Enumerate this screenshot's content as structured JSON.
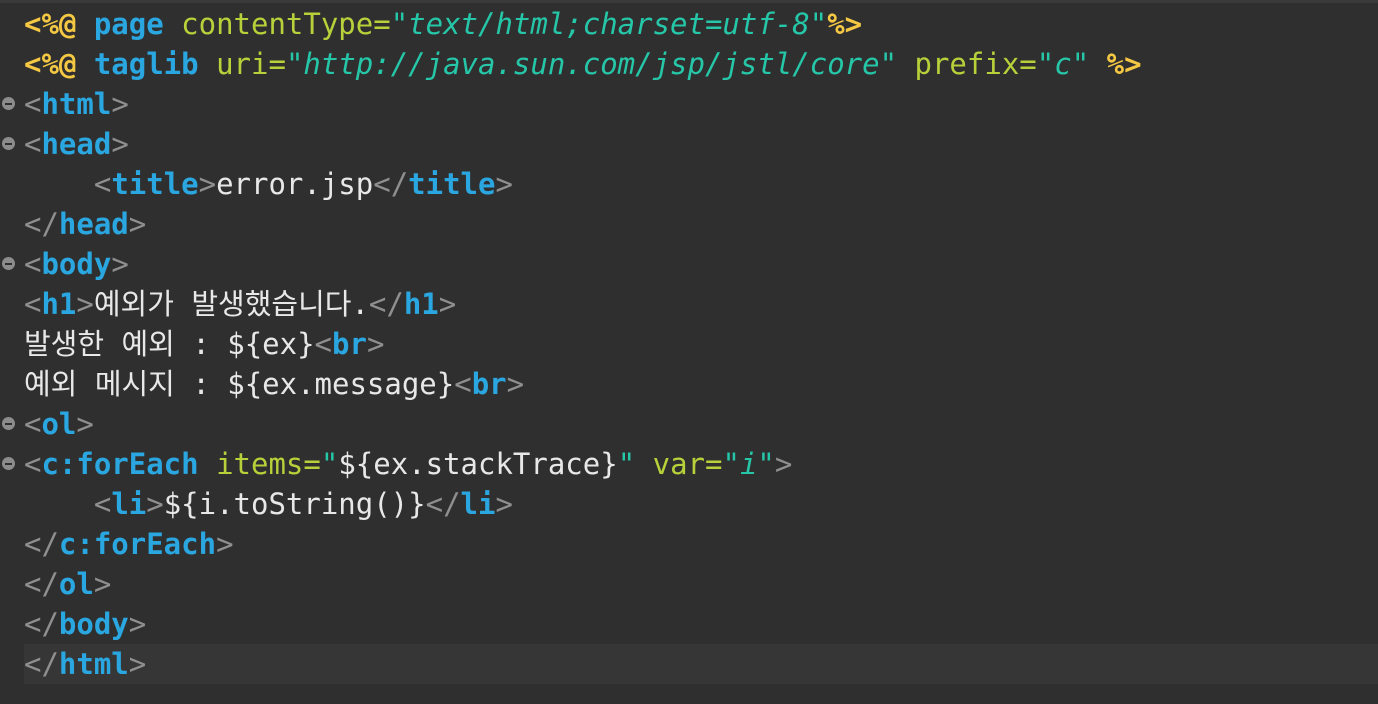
{
  "editor": {
    "lines": [
      {
        "n": 1,
        "fold": false,
        "parts": [
          {
            "c": "dir",
            "t": "<%@ "
          },
          {
            "c": "kw",
            "t": "page"
          },
          {
            "c": "txt",
            "t": " "
          },
          {
            "c": "attr",
            "t": "contentType"
          },
          {
            "c": "eq",
            "t": "="
          },
          {
            "c": "q",
            "t": "\""
          },
          {
            "c": "str",
            "t": "text/html;charset=utf-8"
          },
          {
            "c": "q",
            "t": "\""
          },
          {
            "c": "dir",
            "t": "%>"
          }
        ]
      },
      {
        "n": 2,
        "fold": false,
        "parts": [
          {
            "c": "dir",
            "t": "<%@ "
          },
          {
            "c": "kw",
            "t": "taglib"
          },
          {
            "c": "txt",
            "t": " "
          },
          {
            "c": "attr",
            "t": "uri"
          },
          {
            "c": "eq",
            "t": "="
          },
          {
            "c": "q",
            "t": "\""
          },
          {
            "c": "str",
            "t": "http://java.sun.com/jsp/jstl/core"
          },
          {
            "c": "q",
            "t": "\""
          },
          {
            "c": "txt",
            "t": " "
          },
          {
            "c": "attr",
            "t": "prefix"
          },
          {
            "c": "eq",
            "t": "="
          },
          {
            "c": "q",
            "t": "\""
          },
          {
            "c": "str",
            "t": "c"
          },
          {
            "c": "q",
            "t": "\""
          },
          {
            "c": "txt",
            "t": " "
          },
          {
            "c": "dir",
            "t": "%>"
          }
        ]
      },
      {
        "n": 3,
        "fold": true,
        "parts": [
          {
            "c": "brk",
            "t": "<"
          },
          {
            "c": "tag",
            "t": "html"
          },
          {
            "c": "brk",
            "t": ">"
          }
        ]
      },
      {
        "n": 4,
        "fold": true,
        "parts": [
          {
            "c": "brk",
            "t": "<"
          },
          {
            "c": "tag",
            "t": "head"
          },
          {
            "c": "brk",
            "t": ">"
          }
        ]
      },
      {
        "n": 5,
        "fold": false,
        "parts": [
          {
            "c": "txt",
            "t": "    "
          },
          {
            "c": "brk",
            "t": "<"
          },
          {
            "c": "tag",
            "t": "title"
          },
          {
            "c": "brk",
            "t": ">"
          },
          {
            "c": "txt",
            "t": "error.jsp"
          },
          {
            "c": "brk",
            "t": "</"
          },
          {
            "c": "tag",
            "t": "title"
          },
          {
            "c": "brk",
            "t": ">"
          }
        ]
      },
      {
        "n": 6,
        "fold": false,
        "parts": [
          {
            "c": "brk",
            "t": "</"
          },
          {
            "c": "tag",
            "t": "head"
          },
          {
            "c": "brk",
            "t": ">"
          }
        ]
      },
      {
        "n": 7,
        "fold": true,
        "parts": [
          {
            "c": "brk",
            "t": "<"
          },
          {
            "c": "tag",
            "t": "body"
          },
          {
            "c": "brk",
            "t": ">"
          }
        ]
      },
      {
        "n": 8,
        "fold": false,
        "parts": [
          {
            "c": "brk",
            "t": "<"
          },
          {
            "c": "tag",
            "t": "h1"
          },
          {
            "c": "brk",
            "t": ">"
          },
          {
            "c": "txt",
            "t": "예외가 발생했습니다."
          },
          {
            "c": "brk",
            "t": "</"
          },
          {
            "c": "tag",
            "t": "h1"
          },
          {
            "c": "brk",
            "t": ">"
          }
        ]
      },
      {
        "n": 9,
        "fold": false,
        "parts": [
          {
            "c": "txt",
            "t": "발생한 예외 : ${ex}"
          },
          {
            "c": "brk",
            "t": "<"
          },
          {
            "c": "tag",
            "t": "br"
          },
          {
            "c": "brk",
            "t": ">"
          }
        ]
      },
      {
        "n": 10,
        "fold": false,
        "parts": [
          {
            "c": "txt",
            "t": "예외 메시지 : ${ex.message}"
          },
          {
            "c": "brk",
            "t": "<"
          },
          {
            "c": "tag",
            "t": "br"
          },
          {
            "c": "brk",
            "t": ">"
          }
        ]
      },
      {
        "n": 11,
        "fold": true,
        "parts": [
          {
            "c": "brk",
            "t": "<"
          },
          {
            "c": "tag",
            "t": "ol"
          },
          {
            "c": "brk",
            "t": ">"
          }
        ]
      },
      {
        "n": 12,
        "fold": true,
        "parts": [
          {
            "c": "brk",
            "t": "<"
          },
          {
            "c": "tag",
            "t": "c:forEach"
          },
          {
            "c": "txt",
            "t": " "
          },
          {
            "c": "attr",
            "t": "items"
          },
          {
            "c": "eq",
            "t": "="
          },
          {
            "c": "q",
            "t": "\""
          },
          {
            "c": "el",
            "t": "${ex.stackTrace}"
          },
          {
            "c": "q",
            "t": "\""
          },
          {
            "c": "txt",
            "t": " "
          },
          {
            "c": "attr",
            "t": "var"
          },
          {
            "c": "eq",
            "t": "="
          },
          {
            "c": "q",
            "t": "\""
          },
          {
            "c": "str",
            "t": "i"
          },
          {
            "c": "q",
            "t": "\""
          },
          {
            "c": "brk",
            "t": ">"
          }
        ]
      },
      {
        "n": 13,
        "fold": false,
        "parts": [
          {
            "c": "txt",
            "t": "    "
          },
          {
            "c": "brk",
            "t": "<"
          },
          {
            "c": "tag",
            "t": "li"
          },
          {
            "c": "brk",
            "t": ">"
          },
          {
            "c": "txt",
            "t": "${i.toString()}"
          },
          {
            "c": "brk",
            "t": "</"
          },
          {
            "c": "tag",
            "t": "li"
          },
          {
            "c": "brk",
            "t": ">"
          }
        ]
      },
      {
        "n": 14,
        "fold": false,
        "parts": [
          {
            "c": "brk",
            "t": "</"
          },
          {
            "c": "tag",
            "t": "c:forEach"
          },
          {
            "c": "brk",
            "t": ">"
          }
        ]
      },
      {
        "n": 15,
        "fold": false,
        "parts": [
          {
            "c": "brk",
            "t": "</"
          },
          {
            "c": "tag",
            "t": "ol"
          },
          {
            "c": "brk",
            "t": ">"
          }
        ]
      },
      {
        "n": 16,
        "fold": false,
        "parts": [
          {
            "c": "brk",
            "t": "</"
          },
          {
            "c": "tag",
            "t": "body"
          },
          {
            "c": "brk",
            "t": ">"
          }
        ]
      },
      {
        "n": 17,
        "fold": false,
        "current": true,
        "parts": [
          {
            "c": "brk",
            "t": "</"
          },
          {
            "c": "tag",
            "t": "html"
          },
          {
            "c": "brk",
            "t": ">"
          }
        ]
      }
    ]
  }
}
